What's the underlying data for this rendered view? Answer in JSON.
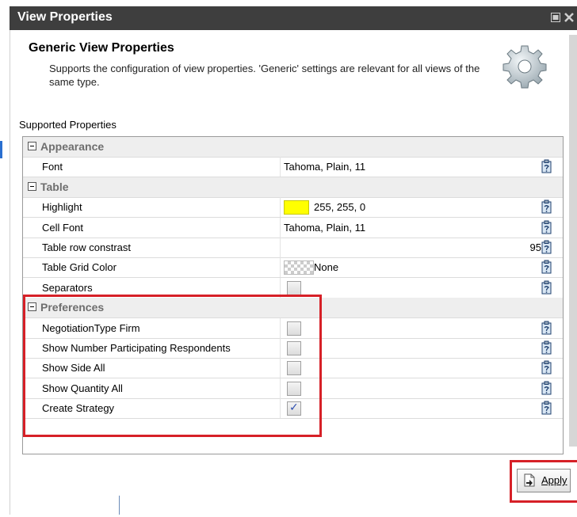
{
  "window": {
    "title": "View Properties"
  },
  "header": {
    "title": "Generic View Properties",
    "description": "Supports the configuration of view properties. 'Generic' settings are relevant for all views of the same type."
  },
  "supported_label": "Supported Properties",
  "grid": {
    "rows": [
      {
        "kind": "category",
        "label": "Appearance"
      },
      {
        "kind": "text",
        "label": "Font",
        "value": "Tahoma, Plain, 11"
      },
      {
        "kind": "category",
        "label": "Table"
      },
      {
        "kind": "color",
        "label": "Highlight",
        "value": "255, 255, 0",
        "color": "#ffff00"
      },
      {
        "kind": "text",
        "label": "Cell Font",
        "value": "Tahoma, Plain, 11"
      },
      {
        "kind": "number",
        "label": "Table row constrast",
        "value": "95"
      },
      {
        "kind": "colornone",
        "label": "Table Grid Color",
        "value": "None"
      },
      {
        "kind": "checkbox",
        "label": "Separators",
        "checked": false
      },
      {
        "kind": "category",
        "label": "Preferences"
      },
      {
        "kind": "checkbox",
        "label": "NegotiationType Firm",
        "checked": false
      },
      {
        "kind": "checkbox",
        "label": "Show Number Participating Respondents",
        "checked": false
      },
      {
        "kind": "checkbox",
        "label": "Show Side All",
        "checked": false
      },
      {
        "kind": "checkbox",
        "label": "Show Quantity All",
        "checked": false
      },
      {
        "kind": "checkbox",
        "label": "Create Strategy",
        "checked": true
      }
    ]
  },
  "apply_button": {
    "label": "Apply"
  },
  "colors": {
    "titlebar": "#3e3e3e",
    "highlight_box": "#d62027",
    "check": "#2e4fb0"
  },
  "icons": [
    "restore-icon",
    "close-icon",
    "gear-icon",
    "clipboard-icon",
    "apply-icon"
  ]
}
